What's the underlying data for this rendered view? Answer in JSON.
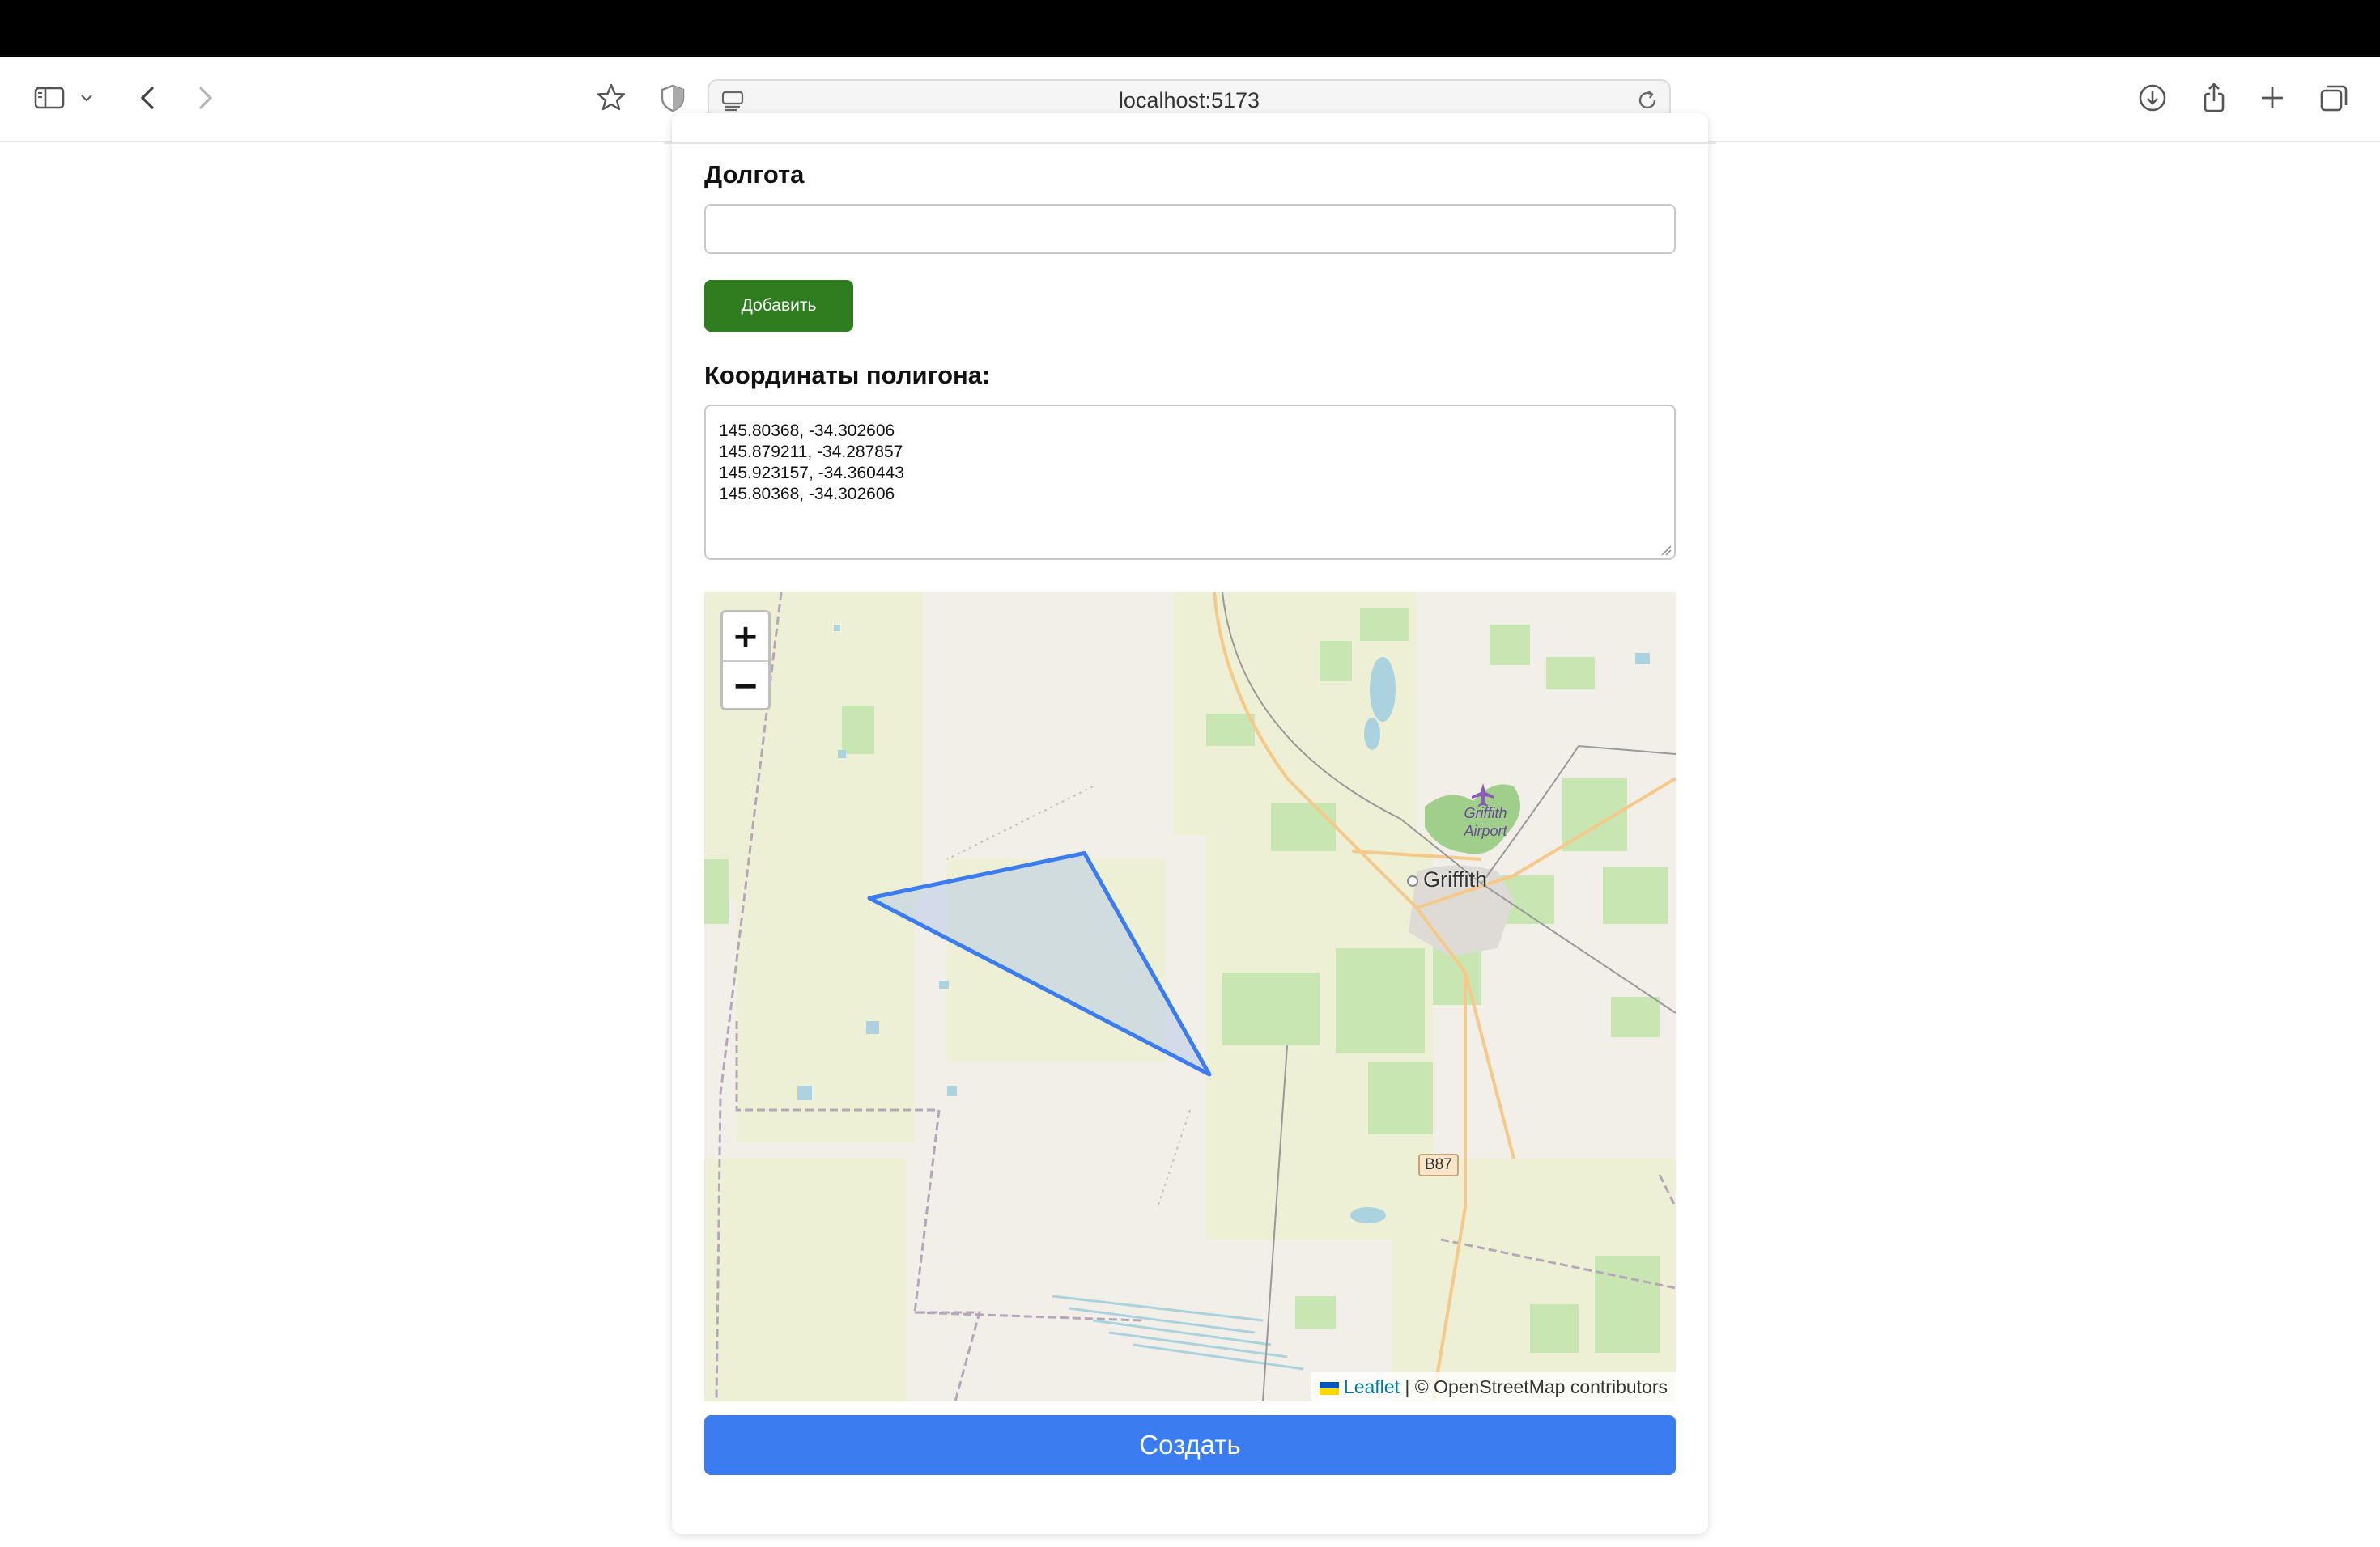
{
  "browser": {
    "url": "localhost:5173",
    "icons": [
      "sidebar-icon",
      "chevron-down-icon",
      "back-icon",
      "forward-icon",
      "star-icon",
      "shield-icon",
      "site-settings-icon",
      "reload-icon",
      "download-icon",
      "share-icon",
      "new-tab-icon",
      "tabs-overview-icon"
    ]
  },
  "form": {
    "longitude_label": "Долгота",
    "longitude_value": "",
    "add_button": "Добавить",
    "coords_label": "Координаты полигона:",
    "coords_text": "145.80368, -34.302606\n145.879211, -34.287857\n145.923157, -34.360443\n145.80368, -34.302606",
    "create_button": "Создать"
  },
  "map": {
    "polygon": [
      [
        145.80368,
        -34.302606
      ],
      [
        145.879211,
        -34.287857
      ],
      [
        145.923157,
        -34.360443
      ],
      [
        145.80368,
        -34.302606
      ]
    ],
    "zoom_in": "+",
    "zoom_out": "−",
    "place_label": "Griffith",
    "airport_label_1": "Griffith",
    "airport_label_2": "Airport",
    "road_label": "B87",
    "attribution_link": "Leaflet",
    "attribution_text": "| © OpenStreetMap contributors",
    "colors": {
      "polygon_stroke": "#3b7cf0",
      "polygon_fill": "#aec3ec",
      "land": "#f2efe9",
      "farmland": "#eef0d5",
      "orchard": "#aedfa3",
      "water": "#aad3df"
    }
  },
  "colors": {
    "add_button": "#2e7d1f",
    "create_button": "#3b7cf0"
  }
}
